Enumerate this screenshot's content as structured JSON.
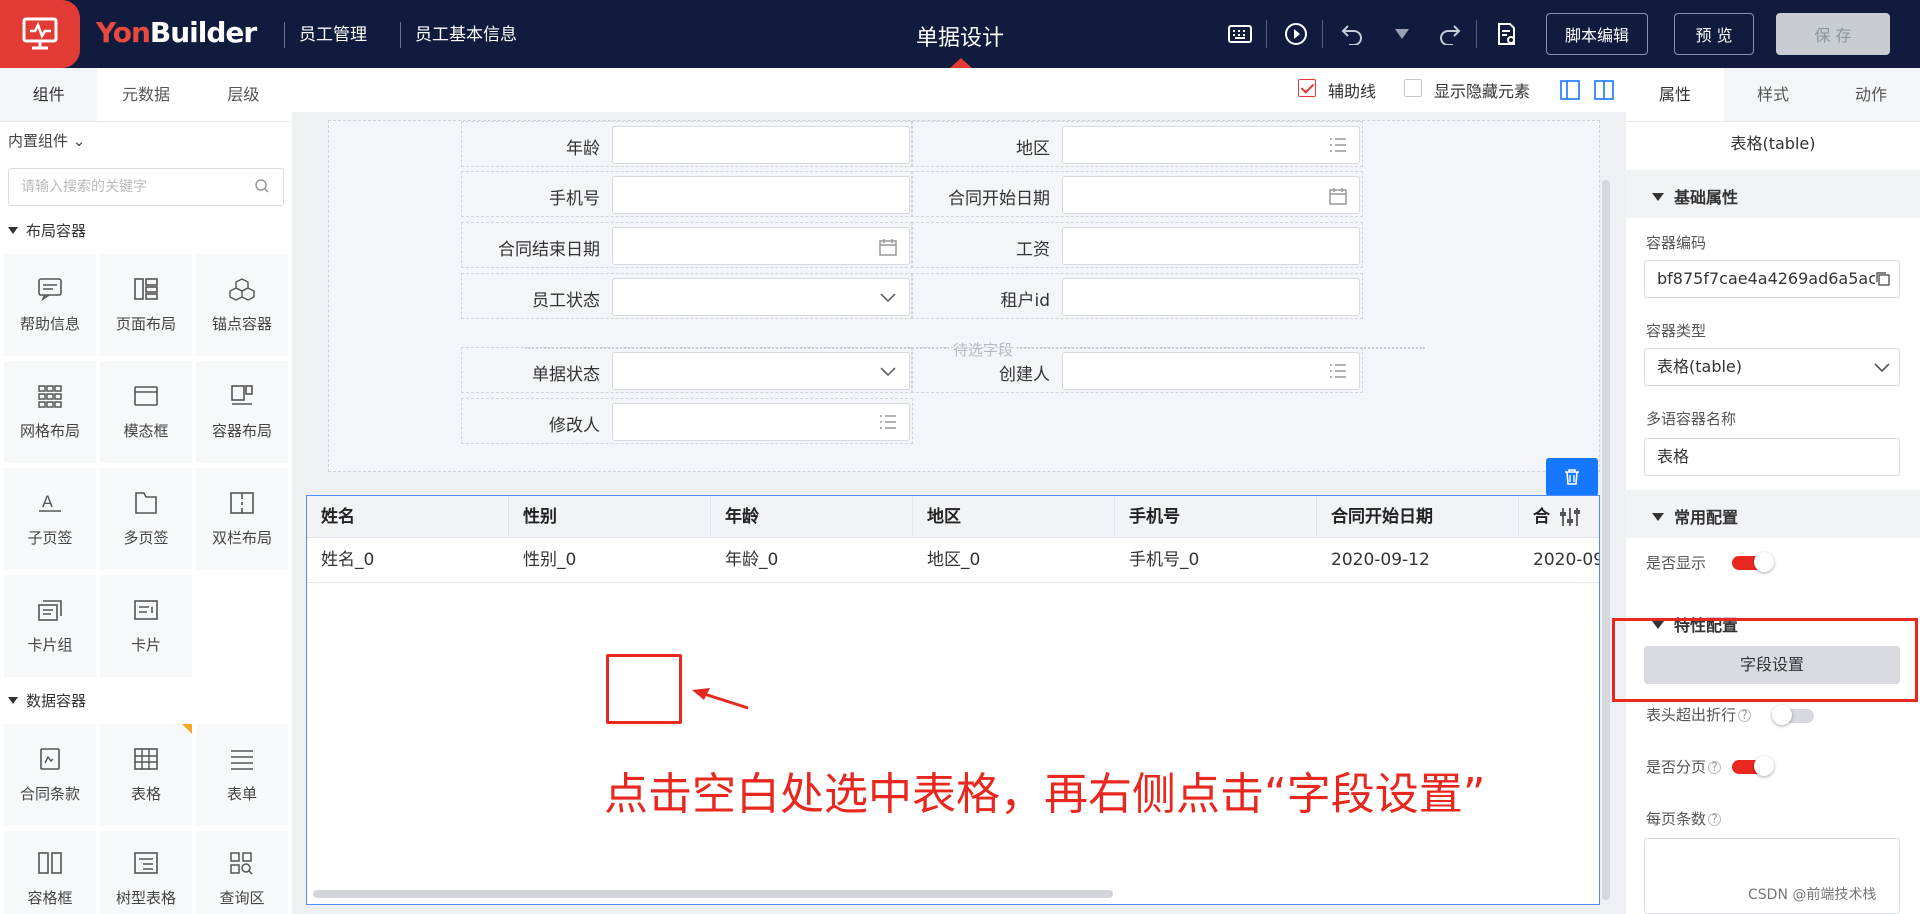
{
  "header": {
    "brand_yon": "Yon",
    "brand_builder": "Builder",
    "breadcrumb": [
      "员工管理",
      "员工基本信息"
    ],
    "page_title": "单据设计",
    "script_btn": "脚本编辑",
    "preview_btn": "预 览",
    "save_btn": "保 存"
  },
  "left": {
    "tabs": [
      "组件",
      "元数据",
      "层级"
    ],
    "builtin": "内置组件",
    "search_placeholder": "请输入搜索的关键字",
    "sections": [
      {
        "title": "布局容器",
        "items": [
          "帮助信息",
          "页面布局",
          "锚点容器",
          "网格布局",
          "模态框",
          "容器布局",
          "子页签",
          "多页签",
          "双栏布局",
          "卡片组",
          "卡片"
        ]
      },
      {
        "title": "数据容器",
        "items": [
          "合同条款",
          "表格",
          "表单",
          "容格框",
          "树型表格",
          "查询区"
        ]
      }
    ]
  },
  "canvas": {
    "checkbox_aux": "辅助线",
    "checkbox_hidden": "显示隐藏元素",
    "pending_fields": "待选字段",
    "form_fields": {
      "age": "年龄",
      "region": "地区",
      "phone": "手机号",
      "contract_start": "合同开始日期",
      "contract_end": "合同结束日期",
      "salary": "工资",
      "status": "员工状态",
      "tenant": "租户id",
      "doc_status": "单据状态",
      "creator": "创建人",
      "modifier": "修改人"
    },
    "table": {
      "columns": [
        "姓名",
        "性别",
        "年龄",
        "地区",
        "手机号",
        "合同开始日期",
        "合"
      ],
      "row": [
        "姓名_0",
        "性别_0",
        "年龄_0",
        "地区_0",
        "手机号_0",
        "2020-09-12",
        "2020-09"
      ]
    },
    "annotation": "点击空白处选中表格，再右侧点击“字段设置”"
  },
  "right": {
    "tabs": [
      "属性",
      "样式",
      "动作"
    ],
    "component": "表格(table)",
    "basic": "基础属性",
    "code_label": "容器编码",
    "code_value": "bf875f7cae4a4269ad6a5ac",
    "type_label": "容器类型",
    "type_value": "表格(table)",
    "ml_label": "多语容器名称",
    "ml_value": "表格",
    "common": "常用配置",
    "show_label": "是否显示",
    "special": "特性配置",
    "field_btn": "字段设置",
    "wrap_label": "表头超出折行",
    "paging_label": "是否分页",
    "per_page_label": "每页条数",
    "show_on": true,
    "wrap_on": false,
    "paging_on": true
  },
  "watermark": "CSDN @前端技术栈"
}
